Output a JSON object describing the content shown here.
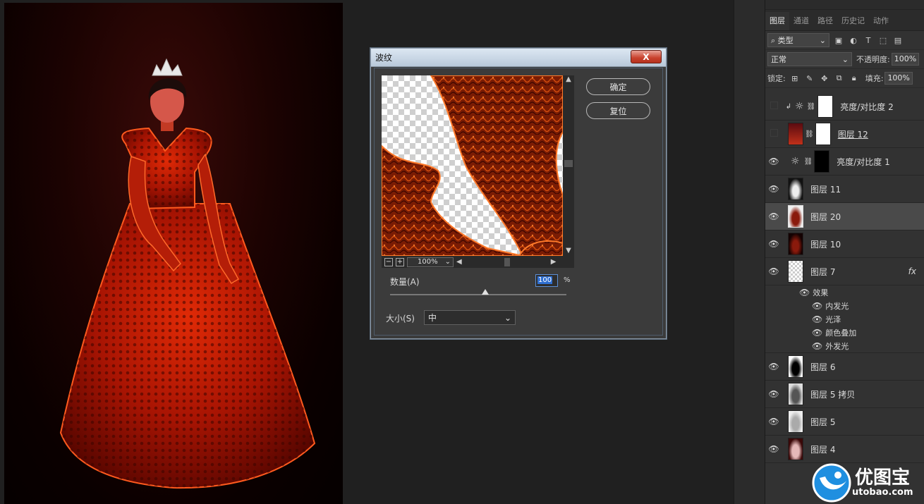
{
  "panel": {
    "tabs": [
      "图层",
      "通道",
      "路径",
      "历史记录",
      "动作"
    ],
    "filter_label": "类型",
    "blend_mode": "正常",
    "opacity_label": "不透明度:",
    "opacity_value": "100%",
    "lock_label": "锁定:",
    "fill_label": "填充:",
    "fill_value": "100%",
    "layers": [
      {
        "name": "亮度/对比度 2",
        "visible": false,
        "thumb": "white"
      },
      {
        "name": "图层 12",
        "visible": false,
        "thumb": "photo"
      },
      {
        "name": "亮度/对比度 1",
        "visible": true,
        "thumb": "mask"
      },
      {
        "name": "图层 11",
        "visible": true,
        "thumb": "white-dress"
      },
      {
        "name": "图层 20",
        "visible": true,
        "thumb": "red-dress"
      },
      {
        "name": "图层 10",
        "visible": true,
        "thumb": "red-dress-dark"
      },
      {
        "name": "图层 7",
        "visible": true,
        "thumb": "checker",
        "fx": "fx"
      },
      {
        "name": "图层 6",
        "visible": true,
        "thumb": "black-dress"
      },
      {
        "name": "图层 5 拷贝",
        "visible": true,
        "thumb": "gray-dress"
      },
      {
        "name": "图层 5",
        "visible": true,
        "thumb": "light-dress"
      },
      {
        "name": "图层 4",
        "visible": true,
        "thumb": "pink-dress"
      }
    ],
    "effects_header": "效果",
    "effects": [
      "内发光",
      "光泽",
      "颜色叠加",
      "外发光"
    ]
  },
  "dialog": {
    "title": "波纹",
    "close_label": "X",
    "ok_label": "确定",
    "reset_label": "复位",
    "zoom_value": "100%",
    "zoom_out": "−",
    "zoom_in": "+",
    "amount_label": "数量(A)",
    "amount_value": "100",
    "amount_unit": "%",
    "amount_fraction": 0.54,
    "size_label": "大小(S)",
    "size_value": "中"
  },
  "watermark": {
    "text": "优图宝",
    "sub": "utobao.com"
  },
  "colors": {
    "dress_red": "#c81e05",
    "panel_bg": "#323232",
    "canvas_bg": "#202020",
    "selected_row": "#4a4a4a"
  }
}
